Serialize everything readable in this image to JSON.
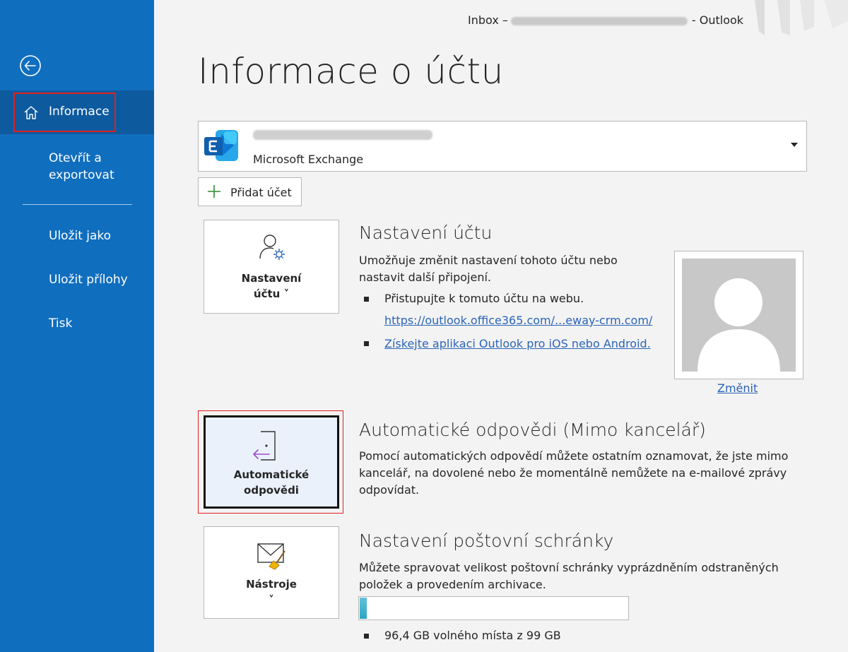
{
  "window": {
    "title_prefix": "Inbox –",
    "title_suffix": "-  Outlook"
  },
  "sidebar": {
    "back_icon": "back-arrow-circle-icon",
    "items": [
      {
        "label": "Informace",
        "icon": "home-icon",
        "active": true
      },
      {
        "label": "Otevřít a\nexportovat"
      },
      {
        "label": "Uložit jako"
      },
      {
        "label": "Uložit přílohy"
      },
      {
        "label": "Tisk"
      }
    ]
  },
  "page": {
    "title": "Informace o účtu"
  },
  "account": {
    "type": "Microsoft Exchange",
    "icon": "exchange-icon"
  },
  "add_account": {
    "label": "Přidat účet"
  },
  "sections": {
    "account_settings": {
      "tile_label": "Nastavení\núčtu ˅",
      "title": "Nastavení účtu",
      "description": "Umožňuje změnit nastavení tohoto účtu nebo nastavit další připojení.",
      "bullet1": "Přistupujte k tomuto účtu na webu.",
      "link1": "https://outlook.office365.com/...eway-crm.com/",
      "link2": "Získejte aplikaci Outlook pro iOS nebo Android.",
      "change_photo": "Změnit"
    },
    "auto_replies": {
      "tile_label": "Automatické\nodpovědi",
      "title": "Automatické odpovědi (Mimo kancelář)",
      "description": "Pomocí automatických odpovědí můžete ostatním oznamovat, že jste mimo kancelář, na dovolené nebo že momentálně nemůžete na e-mailové zprávy odpovídat."
    },
    "mailbox": {
      "tile_label": "Nástroje\n˅",
      "title": "Nastavení poštovní schránky",
      "description": "Můžete spravovat velikost poštovní schránky vyprázdněním odstraněných položek a provedením archivace.",
      "used_fraction": 0.026,
      "free_text": "96,4 GB volného místa z 99 GB"
    }
  },
  "colors": {
    "sidebar_bg": "#106ebe",
    "sidebar_active": "#0e5a9e",
    "highlight_red": "#e02020",
    "link": "#2b64b8",
    "exchange_blue": "#0f78d4"
  }
}
